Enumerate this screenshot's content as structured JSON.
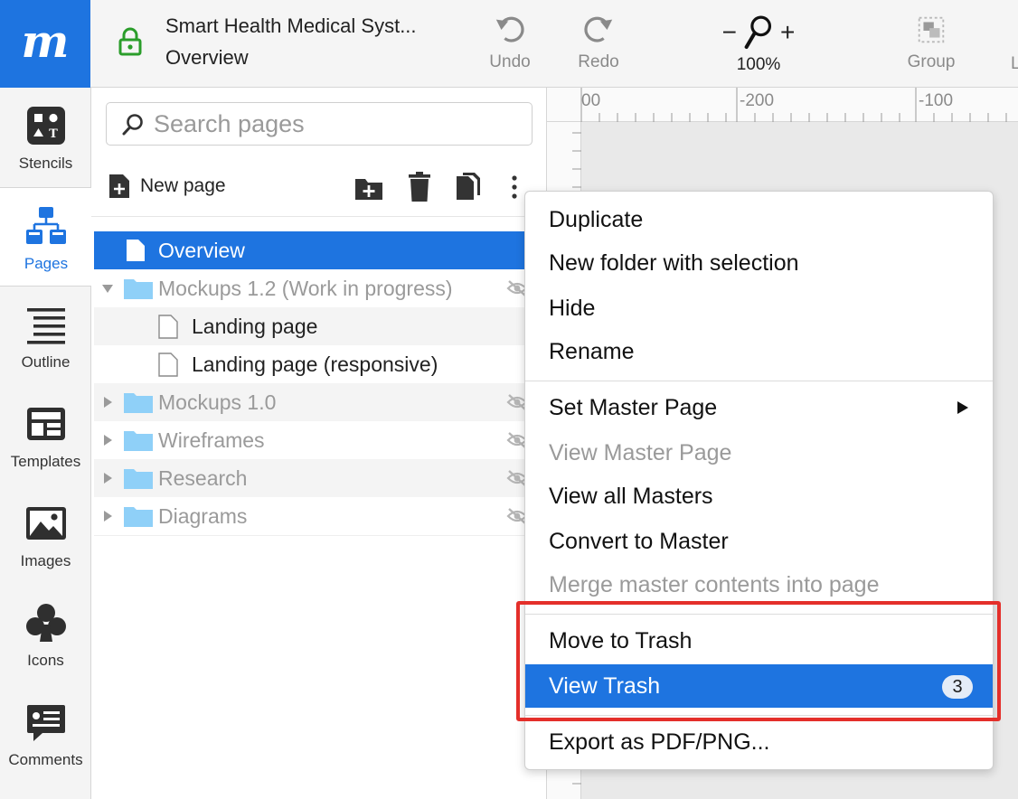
{
  "app": {
    "logo_text": "m",
    "brand_color": "#1e74e0",
    "highlight_color": "#e42f2a",
    "project_title": "Smart Health Medical Syst...",
    "current_page": "Overview"
  },
  "toolbar": {
    "undo_label": "Undo",
    "redo_label": "Redo",
    "zoom_minus": "−",
    "zoom_plus": "+",
    "zoom_value": "100%",
    "group_label": "Group",
    "truncated_label": "L"
  },
  "leftnav": {
    "items": [
      {
        "label": "Stencils",
        "icon": "stencils-icon"
      },
      {
        "label": "Pages",
        "icon": "pages-icon",
        "active": true
      },
      {
        "label": "Outline",
        "icon": "outline-icon"
      },
      {
        "label": "Templates",
        "icon": "templates-icon"
      },
      {
        "label": "Images",
        "icon": "images-icon"
      },
      {
        "label": "Icons",
        "icon": "club-icon"
      },
      {
        "label": "Comments",
        "icon": "comments-icon"
      }
    ]
  },
  "pages_panel": {
    "search_placeholder": "Search pages",
    "new_page_label": "New page",
    "tree": [
      {
        "label": "Overview",
        "type": "page",
        "selected": true
      },
      {
        "label": "Mockups 1.2 (Work in progress)",
        "type": "folder",
        "expanded": true,
        "hidden": true
      },
      {
        "label": "Landing page",
        "type": "page",
        "depth": 1
      },
      {
        "label": "Landing page (responsive)",
        "type": "page",
        "depth": 1
      },
      {
        "label": "Mockups 1.0",
        "type": "folder",
        "hidden": true
      },
      {
        "label": "Wireframes",
        "type": "folder",
        "hidden": true
      },
      {
        "label": "Research",
        "type": "folder",
        "hidden": true
      },
      {
        "label": "Diagrams",
        "type": "folder",
        "hidden": true
      }
    ]
  },
  "ruler": {
    "labels": [
      "00",
      "-200",
      "-100"
    ]
  },
  "context_menu": {
    "groups": [
      [
        {
          "label": "Duplicate"
        },
        {
          "label": "New folder with selection"
        },
        {
          "label": "Hide"
        },
        {
          "label": "Rename"
        }
      ],
      [
        {
          "label": "Set Master Page",
          "submenu": true
        },
        {
          "label": "View Master Page",
          "disabled": true
        },
        {
          "label": "View all Masters"
        },
        {
          "label": "Convert to Master"
        },
        {
          "label": "Merge master contents into page",
          "disabled": true
        }
      ],
      [
        {
          "label": "Move to Trash"
        },
        {
          "label": "View Trash",
          "badge": "3",
          "highlighted": true
        }
      ],
      [
        {
          "label": "Export as PDF/PNG..."
        }
      ]
    ]
  }
}
